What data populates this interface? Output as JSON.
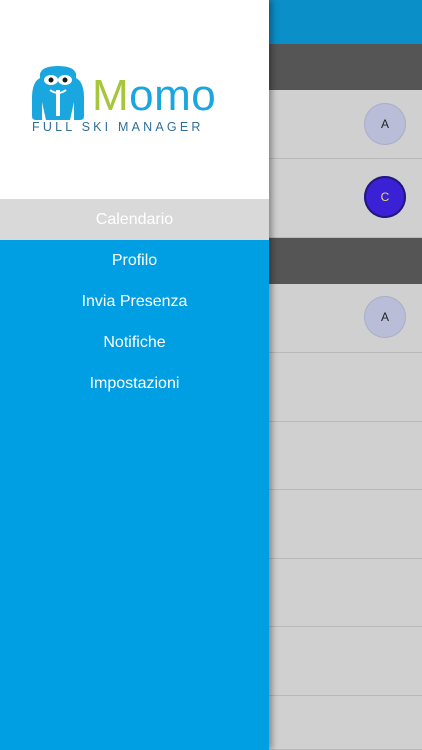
{
  "brand": {
    "name_first": "M",
    "name_rest": "omo",
    "tagline": "FULL SKI MANAGER",
    "colors": {
      "blue": "#1aa6df",
      "green": "#a6c63b"
    },
    "icon": "yeti-mascot-icon"
  },
  "menu": {
    "items": [
      {
        "label": "Calendario",
        "active": true
      },
      {
        "label": "Profilo",
        "active": false
      },
      {
        "label": "Invia Presenza",
        "active": false
      },
      {
        "label": "Notifiche",
        "active": false
      },
      {
        "label": "Impostazioni",
        "active": false
      }
    ]
  },
  "background": {
    "badges": [
      "A",
      "C",
      "A"
    ]
  },
  "colors": {
    "drawer": "#009fe3",
    "topbar": "#0a8fc8",
    "section_header": "#555555",
    "row": "#d0d0d0"
  }
}
